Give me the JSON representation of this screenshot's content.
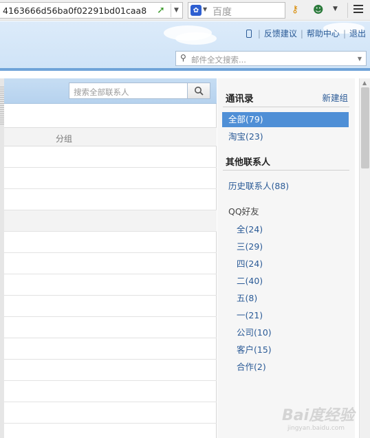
{
  "browser": {
    "url": "4163666d56ba0f02291bd01caa8",
    "search_engine_placeholder": "百度"
  },
  "mail_header": {
    "links": [
      "反馈建议",
      "帮助中心",
      "退出"
    ],
    "search_placeholder": "邮件全文搜索..."
  },
  "contacts": {
    "search_placeholder": "搜索全部联系人",
    "column_header": "分组"
  },
  "sidebar": {
    "title": "通讯录",
    "new_group": "新建组",
    "groups": [
      {
        "label": "全部(79)",
        "active": true
      },
      {
        "label": "淘宝(23)",
        "active": false
      }
    ],
    "other_heading": "其他联系人",
    "history": "历史联系人(88)",
    "qq_heading": "QQ好友",
    "qq_groups": [
      "全(24)",
      "三(29)",
      "四(24)",
      "二(40)",
      "五(8)",
      "一(21)",
      "公司(10)",
      "客户(15)",
      "合作(2)"
    ]
  },
  "watermark": {
    "text": "Bai度经验",
    "sub": "jingyan.baidu.com"
  },
  "colors": {
    "accent": "#4f8fd6",
    "link": "#2a5a96",
    "header_bg": "#cfe3f7"
  }
}
